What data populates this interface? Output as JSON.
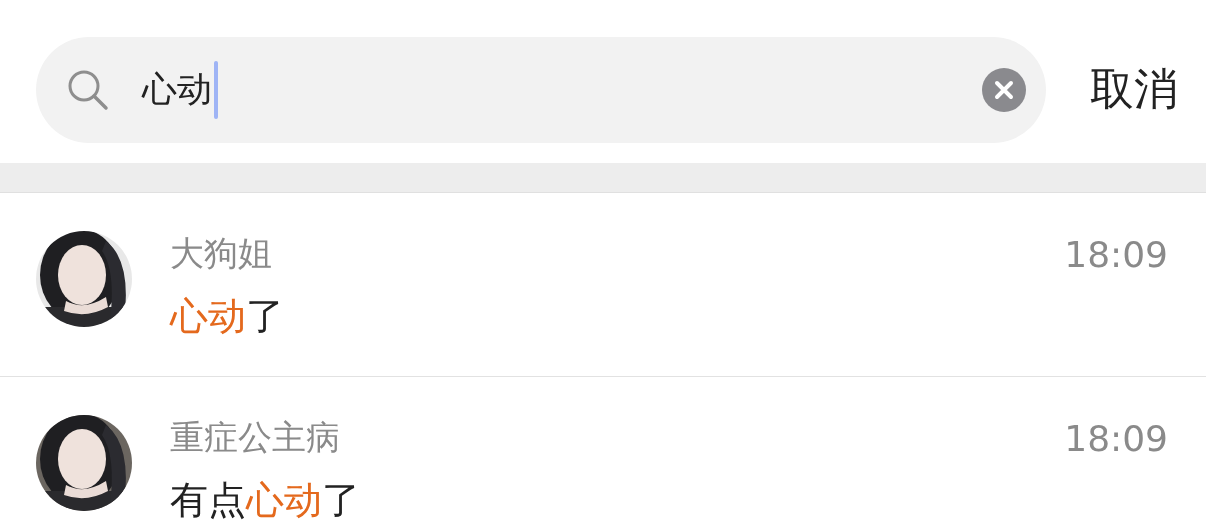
{
  "search": {
    "value": "心动",
    "cancel": "取消"
  },
  "results": [
    {
      "name": "大狗姐",
      "time": "18:09",
      "message": [
        {
          "text": "心动",
          "highlight": true
        },
        {
          "text": "了",
          "highlight": false
        }
      ]
    },
    {
      "name": "重症公主病",
      "time": "18:09",
      "message": [
        {
          "text": "有点",
          "highlight": false
        },
        {
          "text": "心动",
          "highlight": true
        },
        {
          "text": "了",
          "highlight": false
        }
      ]
    }
  ]
}
